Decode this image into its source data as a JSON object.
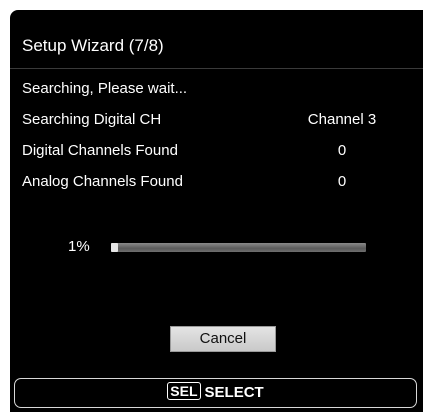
{
  "dialog": {
    "title": "Setup Wizard (7/8)",
    "status": "Searching, Please wait..."
  },
  "rows": [
    {
      "label": "Searching Digital CH",
      "value": "Channel 3"
    },
    {
      "label": "Digital Channels Found",
      "value": "0"
    },
    {
      "label": "Analog Channels Found",
      "value": "0"
    }
  ],
  "progress": {
    "percent_label": "1%",
    "value": 0.01
  },
  "buttons": {
    "cancel": "Cancel"
  },
  "footer": {
    "key": "SEL",
    "action": "SELECT"
  }
}
